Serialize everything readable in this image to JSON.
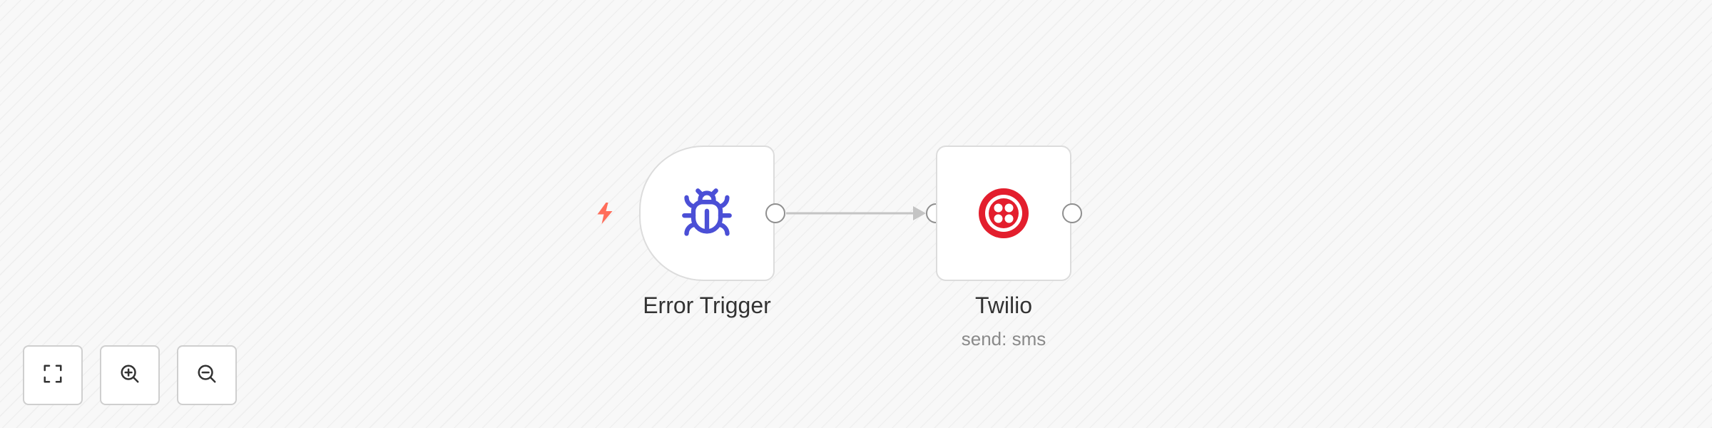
{
  "nodes": {
    "trigger": {
      "title": "Error Trigger",
      "icon": "bug-icon",
      "color": "#4b4fd6"
    },
    "twilio": {
      "title": "Twilio",
      "subtitle": "send: sms",
      "icon": "twilio-icon",
      "color": "#e31e2d"
    }
  },
  "trigger_marker": {
    "icon": "lightning-bolt-icon",
    "color": "#ff6d5a"
  },
  "controls": [
    {
      "name": "fit-view",
      "icon": "fullscreen-icon"
    },
    {
      "name": "zoom-in",
      "icon": "zoom-in-icon"
    },
    {
      "name": "zoom-out",
      "icon": "zoom-out-icon"
    }
  ],
  "colors": {
    "canvas_bg": "#f8f8f8",
    "node_border": "#dcdcdc",
    "connection": "#c4c4c4"
  }
}
